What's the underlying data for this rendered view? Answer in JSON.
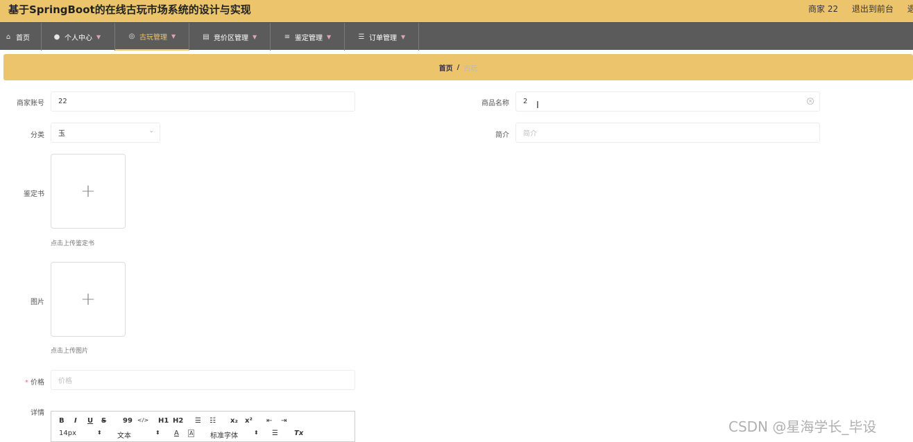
{
  "header": {
    "title": "基于SpringBoot的在线古玩市场系统的设计与实现",
    "user_label": "商家 22",
    "exit_front_label": "退出到前台",
    "exit_label": "退出"
  },
  "nav": {
    "items": [
      {
        "label": "首页",
        "icon": "home-icon"
      },
      {
        "label": "个人中心",
        "icon": "user-icon"
      },
      {
        "label": "古玩管理",
        "icon": "compass-icon"
      },
      {
        "label": "竞价区管理",
        "icon": "clipboard-icon"
      },
      {
        "label": "鉴定管理",
        "icon": "list-icon"
      },
      {
        "label": "订单管理",
        "icon": "sliders-icon"
      }
    ],
    "active": "古玩管理",
    "accent": "#ebc46c"
  },
  "breadcrumb": {
    "home": "首页",
    "separator": "/",
    "current": "古玩"
  },
  "form": {
    "merchant_account": {
      "label": "商家账号",
      "value": "22"
    },
    "product_name": {
      "label": "商品名称",
      "value": "2"
    },
    "category": {
      "label": "分类",
      "value": "玉"
    },
    "intro": {
      "label": "简介",
      "placeholder": "简介"
    },
    "certificate": {
      "label": "鉴定书",
      "hint": "点击上传鉴定书"
    },
    "image": {
      "label": "图片",
      "hint": "点击上传图片"
    },
    "price": {
      "label": "价格",
      "required_mark": "*",
      "placeholder": "价格"
    },
    "detail": {
      "label": "详情"
    }
  },
  "editor": {
    "row1": {
      "bold": "B",
      "italic": "I",
      "underline": "U",
      "strike": "S",
      "quote": "99",
      "code": "</>",
      "h1": "H1",
      "h2": "H2",
      "ordered": "☰",
      "bullet": "☷",
      "sub": "x₂",
      "sup": "x²",
      "indent_out": "⇤",
      "indent_in": "⇥"
    },
    "row2": {
      "size": "14px",
      "size_arrow": "⬍",
      "type": "文本",
      "type_arrow": "⬍",
      "font_color": "A",
      "bg_color": "A",
      "font": "标准字体",
      "font_arrow": "⬍",
      "align": "☰",
      "clear": "Tx"
    }
  },
  "watermark": "CSDN @星海学长_毕设"
}
